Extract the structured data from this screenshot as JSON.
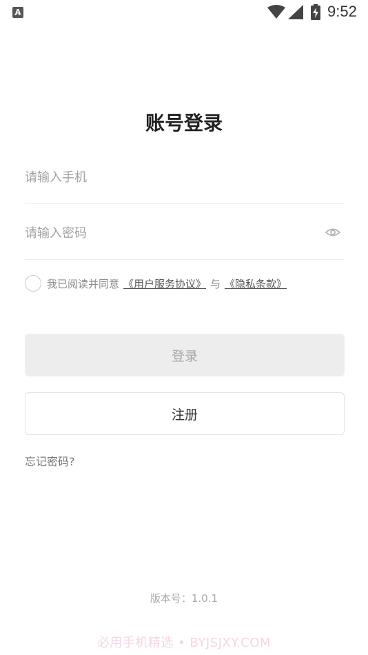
{
  "status_bar": {
    "app_icon_letter": "A",
    "time": "9:52"
  },
  "page": {
    "title": "账号登录"
  },
  "form": {
    "phone_placeholder": "请输入手机",
    "password_placeholder": "请输入密码"
  },
  "agreement": {
    "prefix": "我已阅读并同意",
    "terms_link": "《用户服务协议》",
    "conjunction": "与",
    "privacy_link": "《隐私条款》"
  },
  "buttons": {
    "login": "登录",
    "register": "注册"
  },
  "forgot_password": "忘记密码?",
  "version": "版本号：1.0.1",
  "watermark": "必用手机精选 • BYJSJXY.COM",
  "colors": {
    "muted_text": "#a2a2a2",
    "login_bg": "#ededed",
    "border": "#e2e2e2"
  }
}
